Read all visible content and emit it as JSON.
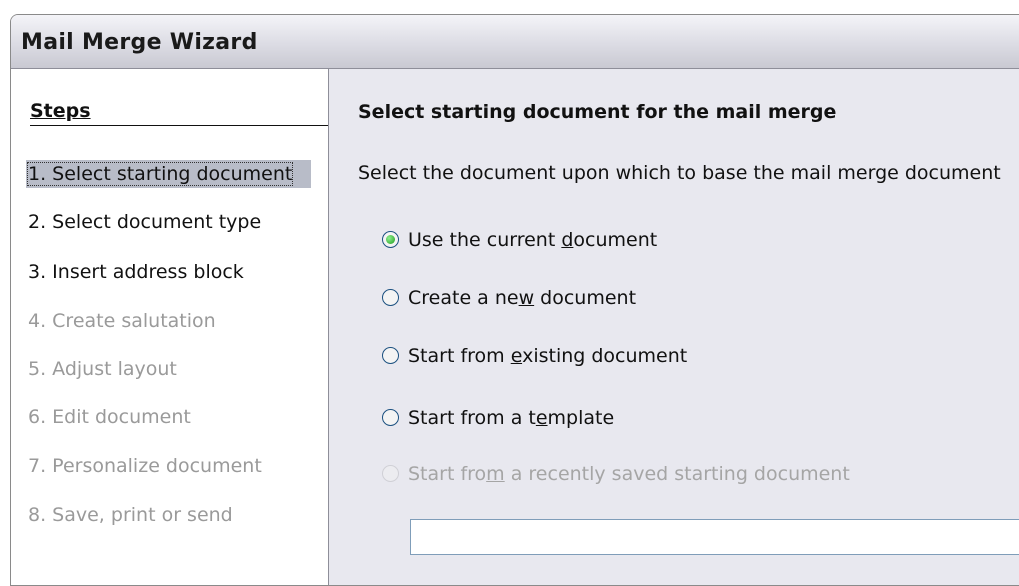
{
  "window": {
    "title": "Mail Merge Wizard"
  },
  "steps": {
    "header": "Steps",
    "items": [
      {
        "label": "1. Select starting document",
        "state": "selected"
      },
      {
        "label": "2. Select document type",
        "state": "enabled"
      },
      {
        "label": "3. Insert address block",
        "state": "enabled"
      },
      {
        "label": "4. Create salutation",
        "state": "disabled"
      },
      {
        "label": "5. Adjust layout",
        "state": "disabled"
      },
      {
        "label": "6. Edit document",
        "state": "disabled"
      },
      {
        "label": "7. Personalize document",
        "state": "disabled"
      },
      {
        "label": "8. Save, print or send",
        "state": "disabled"
      }
    ]
  },
  "page": {
    "heading": "Select starting document for the mail merge",
    "description": "Select the document upon which to base the mail merge document",
    "options": [
      {
        "pre": "Use the current ",
        "accel": "d",
        "post": "ocument",
        "checked": true,
        "enabled": true
      },
      {
        "pre": "Create a ne",
        "accel": "w",
        "post": " document",
        "checked": false,
        "enabled": true
      },
      {
        "pre": "Start from ",
        "accel": "e",
        "post": "xisting document",
        "checked": false,
        "enabled": true
      },
      {
        "pre": "Start from a t",
        "accel": "e",
        "post": "mplate",
        "checked": false,
        "enabled": true
      },
      {
        "pre": "Start fro",
        "accel": "m",
        "post": " a recently saved starting document",
        "checked": false,
        "enabled": false
      }
    ],
    "recent_document_value": ""
  },
  "colors": {
    "accent_radio": "#1f9c1f",
    "selected_step_bg": "#b8bcc8",
    "disabled_text": "#9a9a9a"
  }
}
